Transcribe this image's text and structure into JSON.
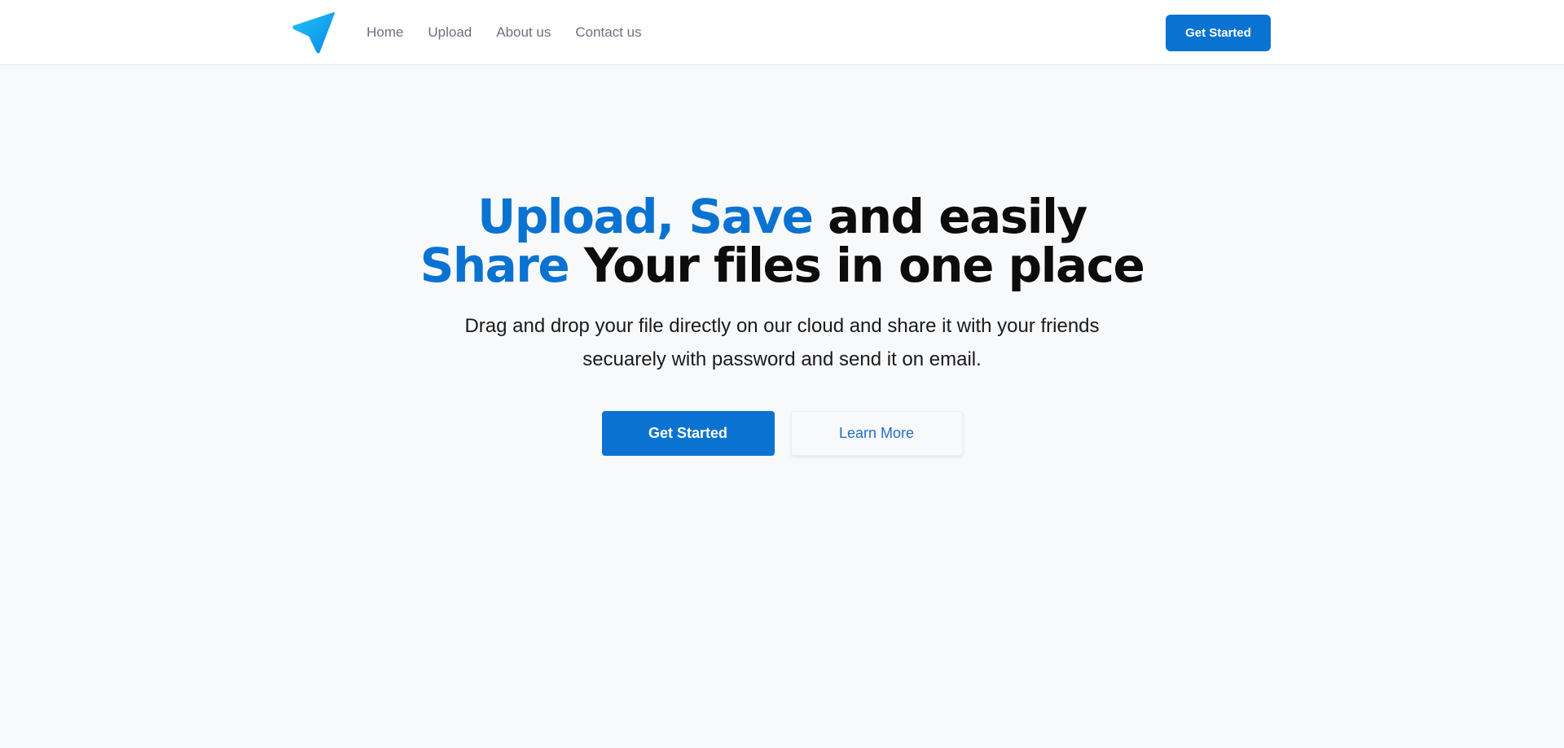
{
  "header": {
    "logo_icon": "paper-plane-icon",
    "nav": {
      "home": "Home",
      "upload": "Upload",
      "about": "About us",
      "contact": "Contact us"
    },
    "cta_label": "Get Started"
  },
  "hero": {
    "title": {
      "line1_accent": "Upload, Save",
      "line1_rest": " and easily",
      "line2_accent": "Share",
      "line2_rest": " Your files in one place"
    },
    "subtitle": "Drag and drop your file directly on our cloud and share it with your friends secuarely with password and send it on email.",
    "primary_label": "Get Started",
    "secondary_label": "Learn More"
  },
  "colors": {
    "accent": "#0a73d1",
    "logo_gradient_start": "#1fc2f5",
    "logo_gradient_end": "#0a8ae6",
    "page_background": "#f8f9fb",
    "header_background": "#ffffff"
  }
}
